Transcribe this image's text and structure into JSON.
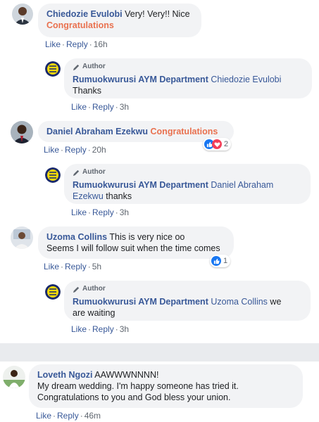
{
  "comments": [
    {
      "name": "Chiedozie Evulobi",
      "text": "Very! Very!! Nice",
      "highlight": "Congratulations",
      "like": "Like",
      "reply": "Reply",
      "time": "16h",
      "avatar_icon": "person-photo-icon"
    },
    {
      "name": "Daniel Abraham Ezekwu",
      "highlight": "Congratulations",
      "like": "Like",
      "reply": "Reply",
      "time": "20h",
      "reaction_count": "2",
      "avatar_icon": "person-photo-icon"
    },
    {
      "name": "Uzoma Collins",
      "text_line1": "This is very nice oo",
      "text_line2": "Seems I will follow suit when the time comes",
      "like": "Like",
      "reply": "Reply",
      "time": "5h",
      "reaction_count": "1",
      "avatar_icon": "person-photo-icon"
    },
    {
      "name": "Loveth Ngozi",
      "text_line1": "AAWWWNNNN!",
      "text_line2": "My dream wedding. I'm happy someone has tried it.",
      "text_line3": "Congratulations to you and God bless your union.",
      "like": "Like",
      "reply": "Reply",
      "time": "46m",
      "avatar_icon": "person-photo-icon"
    }
  ],
  "replies": [
    {
      "badge": "Author",
      "name": "Rumuokwurusi AYM Department",
      "mention": "Chiedozie Evulobi",
      "text": "Thanks",
      "like": "Like",
      "reply": "Reply",
      "time": "3h",
      "avatar_icon": "page-logo-icon"
    },
    {
      "badge": "Author",
      "name": "Rumuokwurusi AYM Department",
      "mention_line1": "Daniel Abraham",
      "mention_line2": "Ezekwu",
      "text": "thanks",
      "like": "Like",
      "reply": "Reply",
      "time": "3h",
      "avatar_icon": "page-logo-icon"
    },
    {
      "badge": "Author",
      "name": "Rumuokwurusi AYM Department",
      "mention": "Uzoma Collins",
      "text_line1": "we",
      "text_line2": "are waiting",
      "like": "Like",
      "reply": "Reply",
      "time": "3h",
      "avatar_icon": "page-logo-icon"
    }
  ],
  "colors": {
    "name": "#385898",
    "highlight": "#e9714f",
    "bubble": "#f2f3f5",
    "like_blue": "#1877f2",
    "love_red": "#f33e58"
  }
}
